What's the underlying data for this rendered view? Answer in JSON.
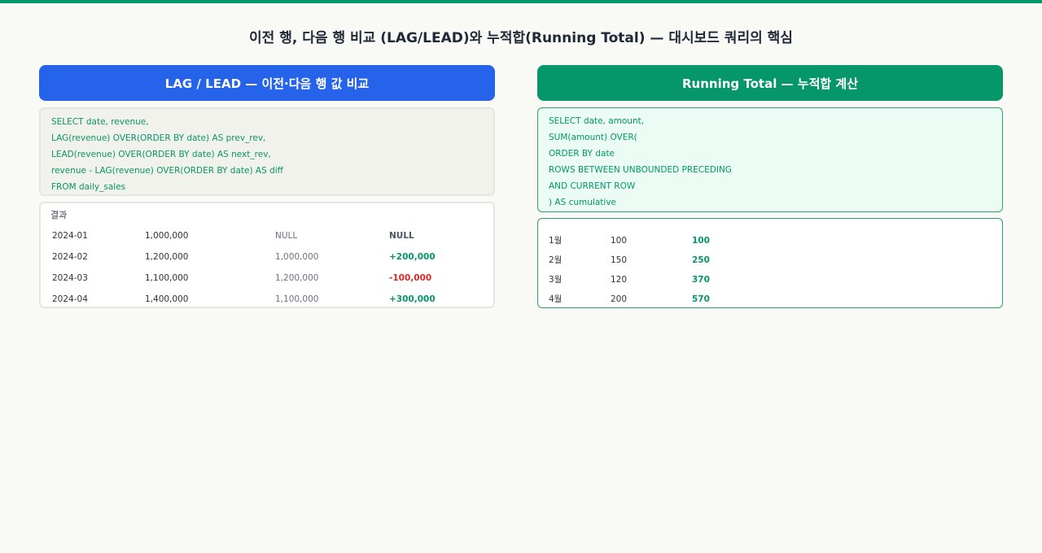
{
  "title": "이전 행, 다음 행 비교 (LAG/LEAD)와 누적합(Running Total) — 대시보드 쿼리의 핵심",
  "left": {
    "header": "LAG / LEAD — 이전·다음 행 값 비교",
    "code": [
      "SELECT date, revenue,",
      "LAG(revenue) OVER(ORDER BY date) AS prev_rev,",
      "LEAD(revenue) OVER(ORDER BY date) AS next_rev,",
      "revenue - LAG(revenue) OVER(ORDER BY date) AS diff",
      "FROM daily_sales"
    ],
    "result_label": "결과",
    "rows": [
      {
        "date": "2024-01",
        "revenue": "1,000,000",
        "prev": "NULL",
        "diff": "NULL"
      },
      {
        "date": "2024-02",
        "revenue": "1,200,000",
        "prev": "1,000,000",
        "diff": "+200,000"
      },
      {
        "date": "2024-03",
        "revenue": "1,100,000",
        "prev": "1,200,000",
        "diff": "-100,000"
      },
      {
        "date": "2024-04",
        "revenue": "1,400,000",
        "prev": "1,100,000",
        "diff": "+300,000"
      }
    ]
  },
  "right": {
    "header": "Running Total — 누적합 계산",
    "code": [
      "SELECT date, amount,",
      "SUM(amount) OVER(",
      "ORDER BY date",
      "ROWS BETWEEN UNBOUNDED PRECEDING",
      "AND CURRENT ROW",
      ") AS cumulative"
    ],
    "rows": [
      {
        "month": "1월",
        "amount": "100",
        "cumulative": "100"
      },
      {
        "month": "2월",
        "amount": "150",
        "cumulative": "250"
      },
      {
        "month": "3월",
        "amount": "120",
        "cumulative": "370"
      },
      {
        "month": "4월",
        "amount": "200",
        "cumulative": "570"
      }
    ]
  },
  "colors": {
    "accent_green": "#059669",
    "accent_blue": "#2563eb",
    "negative_red": "#dc2626"
  }
}
